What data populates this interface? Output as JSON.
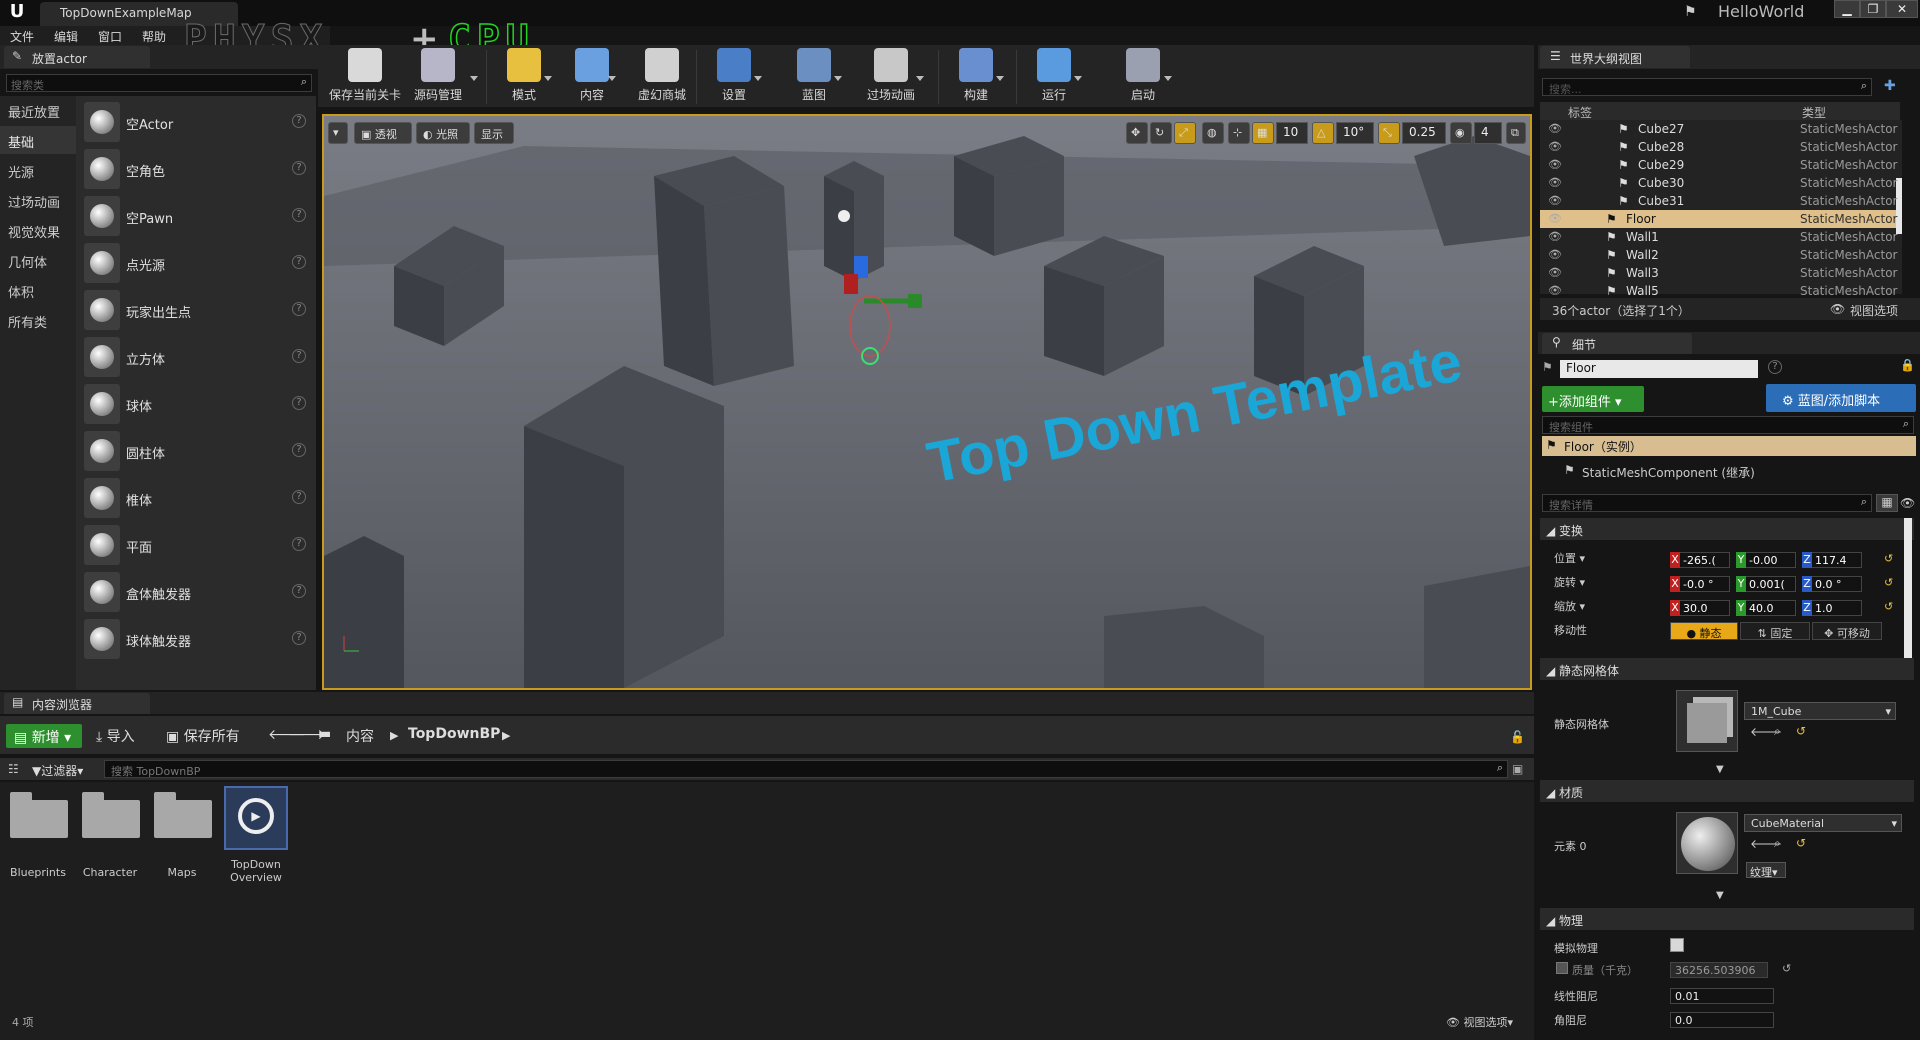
{
  "window": {
    "doc_tab": "TopDownExampleMap",
    "project": "HelloWorld",
    "min": "▁",
    "max": "❐",
    "close": "✕"
  },
  "menu": [
    "文件",
    "编辑",
    "窗口",
    "帮助"
  ],
  "overlay": {
    "physx": "PHYSX",
    "plus": "+",
    "cpu": "CPU"
  },
  "toolbar": [
    {
      "label": "保存当前关卡",
      "color": "#d9d9d9"
    },
    {
      "label": "源码管理",
      "color": "#b6b6c8"
    },
    {
      "label": "模式",
      "color": "#e8c040"
    },
    {
      "label": "内容",
      "color": "#6aa0e0"
    },
    {
      "label": "虚幻商城",
      "color": "#d0d0d0"
    },
    {
      "label": "设置",
      "color": "#4a7fc8"
    },
    {
      "label": "蓝图",
      "color": "#6a8fc0"
    },
    {
      "label": "过场动画",
      "color": "#c8c8c8"
    },
    {
      "label": "构建",
      "color": "#6a8fd0"
    },
    {
      "label": "运行",
      "color": "#5a9be0"
    },
    {
      "label": "启动",
      "color": "#9aa0b0"
    }
  ],
  "place_panel": {
    "tab": "放置actor",
    "search_placeholder": "搜索类",
    "categories": [
      "最近放置",
      "基础",
      "光源",
      "过场动画",
      "视觉效果",
      "几何体",
      "体积",
      "所有类"
    ],
    "selected_category": "基础",
    "items": [
      "空Actor",
      "空角色",
      "空Pawn",
      "点光源",
      "玩家出生点",
      "立方体",
      "球体",
      "圆柱体",
      "椎体",
      "平面",
      "盒体触发器",
      "球体触发器"
    ],
    "help": "?"
  },
  "viewport": {
    "buttons": [
      "透视",
      "光照",
      "显示"
    ],
    "snap": {
      "grid": "10",
      "rot": "10°",
      "scale": "0.25",
      "cam": "4"
    },
    "text": "Top Down Template"
  },
  "outliner": {
    "tab": "世界大纲视图",
    "search_placeholder": "搜索...",
    "col_label": "标签",
    "col_type": "类型",
    "rows": [
      {
        "name": "Cube27",
        "type": "StaticMeshActor",
        "indent": 1
      },
      {
        "name": "Cube28",
        "type": "StaticMeshActor",
        "indent": 1
      },
      {
        "name": "Cube29",
        "type": "StaticMeshActor",
        "indent": 1
      },
      {
        "name": "Cube30",
        "type": "StaticMeshActor",
        "indent": 1
      },
      {
        "name": "Cube31",
        "type": "StaticMeshActor",
        "indent": 1
      },
      {
        "name": "Floor",
        "type": "StaticMeshActor",
        "indent": 0,
        "selected": true
      },
      {
        "name": "Wall1",
        "type": "StaticMeshActor",
        "indent": 0
      },
      {
        "name": "Wall2",
        "type": "StaticMeshActor",
        "indent": 0
      },
      {
        "name": "Wall3",
        "type": "StaticMeshActor",
        "indent": 0
      },
      {
        "name": "Wall5",
        "type": "StaticMeshActor",
        "indent": 0
      }
    ],
    "footer": "36个actor（选择了1个）",
    "view_options": "视图选项"
  },
  "details": {
    "tab": "细节",
    "name": "Floor",
    "add_component": "+添加组件",
    "blueprint": "蓝图/添加脚本",
    "search_components": "搜索组件",
    "instance": "Floor（实例）",
    "component": "StaticMeshComponent (继承)",
    "search_details": "搜索详情",
    "transform": {
      "section": "变换",
      "location": {
        "label": "位置",
        "x": "-265.(",
        "y": "-0.00",
        "z": "117.4"
      },
      "rotation": {
        "label": "旋转",
        "x": "-0.0 °",
        "y": "0.001(",
        "z": "0.0 °"
      },
      "scale": {
        "label": "缩放",
        "x": "30.0",
        "y": "40.0",
        "z": "1.0"
      },
      "mobility": {
        "label": "移动性",
        "static": "静态",
        "stationary": "固定",
        "movable": "可移动"
      }
    },
    "static_mesh": {
      "section": "静态网格体",
      "label": "静态网格体",
      "value": "1M_Cube"
    },
    "materials": {
      "section": "材质",
      "label": "元素 0",
      "value": "CubeMaterial",
      "texture": "纹理"
    },
    "physics": {
      "section": "物理",
      "simulate": "模拟物理",
      "mass_label": "质量（千克）",
      "mass": "36256.503906",
      "linear_damping_label": "线性阻尼",
      "linear_damping": "0.01",
      "angular_damping_label": "角阻尼",
      "angular_damping": "0.0"
    }
  },
  "content_browser": {
    "tab": "内容浏览器",
    "new": "新增",
    "import": "导入",
    "save_all": "保存所有",
    "path": [
      "内容",
      "TopDownBP"
    ],
    "filter": "过滤器",
    "search_placeholder": "搜索 TopDownBP",
    "items": [
      "Blueprints",
      "Character",
      "Maps",
      "TopDown Overview"
    ],
    "count": "4 项",
    "view_options": "视图选项"
  }
}
